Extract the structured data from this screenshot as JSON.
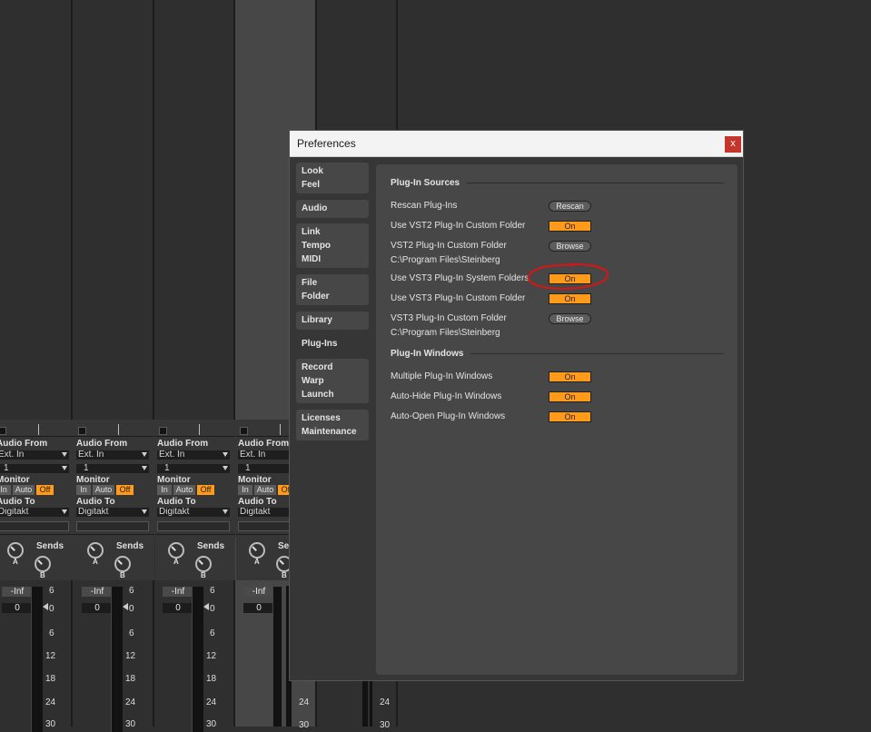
{
  "mixer": {
    "strips": [
      {
        "audio_from_label": "Audio From",
        "input": "Ext. In",
        "channel": "1",
        "monitor_label": "Monitor",
        "monitor_in": "In",
        "monitor_auto": "Auto",
        "monitor_off": "Off",
        "audio_to_label": "Audio To",
        "output": "Digitakt",
        "sends_label": "Sends",
        "send_a": "A",
        "send_b": "B",
        "volume": "-Inf",
        "pan": "0"
      },
      {
        "audio_from_label": "Audio From",
        "input": "Ext. In",
        "channel": "1",
        "monitor_label": "Monitor",
        "monitor_in": "In",
        "monitor_auto": "Auto",
        "monitor_off": "Off",
        "audio_to_label": "Audio To",
        "output": "Digitakt",
        "sends_label": "Sends",
        "send_a": "A",
        "send_b": "B",
        "volume": "-Inf",
        "pan": "0"
      },
      {
        "audio_from_label": "Audio From",
        "input": "Ext. In",
        "channel": "1",
        "monitor_label": "Monitor",
        "monitor_in": "In",
        "monitor_auto": "Auto",
        "monitor_off": "Off",
        "audio_to_label": "Audio To",
        "output": "Digitakt",
        "sends_label": "Sends",
        "send_a": "A",
        "send_b": "B",
        "volume": "-Inf",
        "pan": "0"
      },
      {
        "audio_from_label": "Audio From",
        "input": "Ext. In",
        "channel": "1",
        "monitor_label": "Monitor",
        "monitor_in": "In",
        "monitor_auto": "Auto",
        "monitor_off": "Off",
        "audio_to_label": "Audio To",
        "output": "Digitakt",
        "sends_label": "Sends",
        "send_a": "A",
        "send_b": "B",
        "volume": "-Inf",
        "pan": "0"
      }
    ],
    "scale": [
      "6",
      "0",
      "6",
      "12",
      "18",
      "24",
      "30"
    ],
    "accent_color": "#ff9a1a"
  },
  "dialog": {
    "title": "Preferences",
    "close": "x",
    "sidebar": [
      {
        "lines": [
          "Look",
          "Feel"
        ]
      },
      {
        "lines": [
          "Audio"
        ]
      },
      {
        "lines": [
          "Link",
          "Tempo",
          "MIDI"
        ]
      },
      {
        "lines": [
          "File",
          "Folder"
        ]
      },
      {
        "lines": [
          "Library"
        ]
      },
      {
        "lines": [
          "Plug-Ins"
        ]
      },
      {
        "lines": [
          "Record",
          "Warp",
          "Launch"
        ]
      },
      {
        "lines": [
          "Licenses",
          "Maintenance"
        ]
      }
    ],
    "sources": {
      "header": "Plug-In Sources",
      "rescan_label": "Rescan Plug-Ins",
      "rescan_btn": "Rescan",
      "vst2_custom_use_label": "Use VST2 Plug-In Custom Folder",
      "vst2_custom_use_value": "On",
      "vst2_folder_label": "VST2 Plug-In Custom Folder",
      "vst2_browse": "Browse",
      "vst2_path": "C:\\Program Files\\Steinberg",
      "vst3_system_label": "Use VST3 Plug-In System Folders",
      "vst3_system_value": "On",
      "vst3_custom_use_label": "Use VST3 Plug-In Custom Folder",
      "vst3_custom_use_value": "On",
      "vst3_folder_label": "VST3 Plug-In Custom Folder",
      "vst3_browse": "Browse",
      "vst3_path": "C:\\Program Files\\Steinberg"
    },
    "windows": {
      "header": "Plug-In Windows",
      "multiple_label": "Multiple Plug-In Windows",
      "multiple_value": "On",
      "autohide_label": "Auto-Hide Plug-In Windows",
      "autohide_value": "On",
      "autoopen_label": "Auto-Open Plug-In Windows",
      "autoopen_value": "On"
    },
    "annotation_color": "#d01818"
  }
}
